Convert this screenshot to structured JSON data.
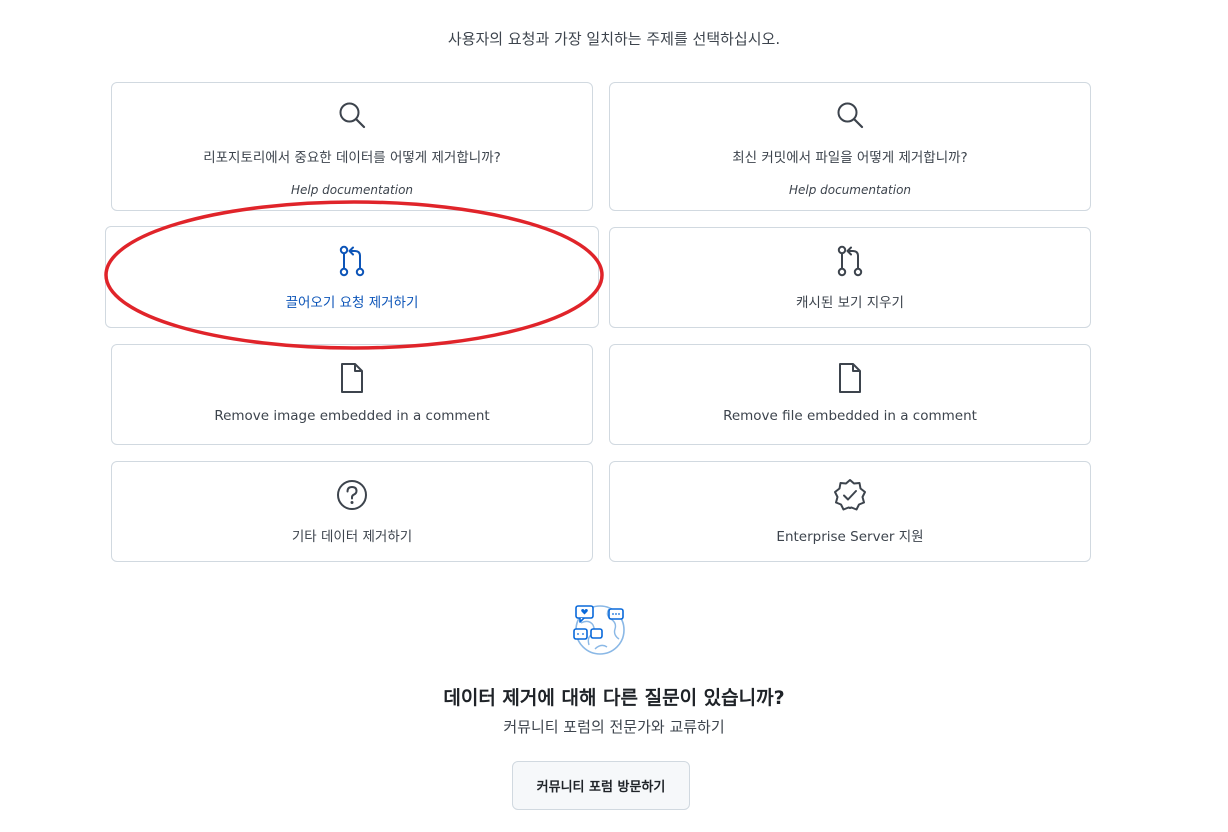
{
  "header": {
    "instruction": "사용자의 요청과 가장 일치하는 주제를 선택하십시오."
  },
  "topics": [
    {
      "icon": "search-icon",
      "label": "리포지토리에서 중요한 데이터를 어떻게 제거합니까?",
      "sublabel": "Help documentation"
    },
    {
      "icon": "search-icon",
      "label": "최신 커밋에서 파일을 어떻게 제거합니까?",
      "sublabel": "Help documentation"
    },
    {
      "icon": "pull-request-icon",
      "label": "끌어오기 요청 제거하기",
      "highlighted": true
    },
    {
      "icon": "pull-request-icon",
      "label": "캐시된 보기 지우기"
    },
    {
      "icon": "file-icon",
      "label": "Remove image embedded in a comment"
    },
    {
      "icon": "file-icon",
      "label": "Remove file embedded in a comment"
    },
    {
      "icon": "question-icon",
      "label": "기타 데이터 제거하기"
    },
    {
      "icon": "verified-badge-icon",
      "label": "Enterprise Server 지원"
    }
  ],
  "forum": {
    "icon": "community-globe-icon",
    "title": "데이터 제거에 대해 다른 질문이 있습니까?",
    "subtitle": "커뮤니티 포럼의 전문가와 교류하기",
    "button_label": "커뮤니티 포럼 방문하기"
  },
  "colors": {
    "accent_blue": "#0d55b8",
    "annotation_red": "#e0242a",
    "border": "#d1d9e0",
    "text_muted": "#3d444d"
  }
}
